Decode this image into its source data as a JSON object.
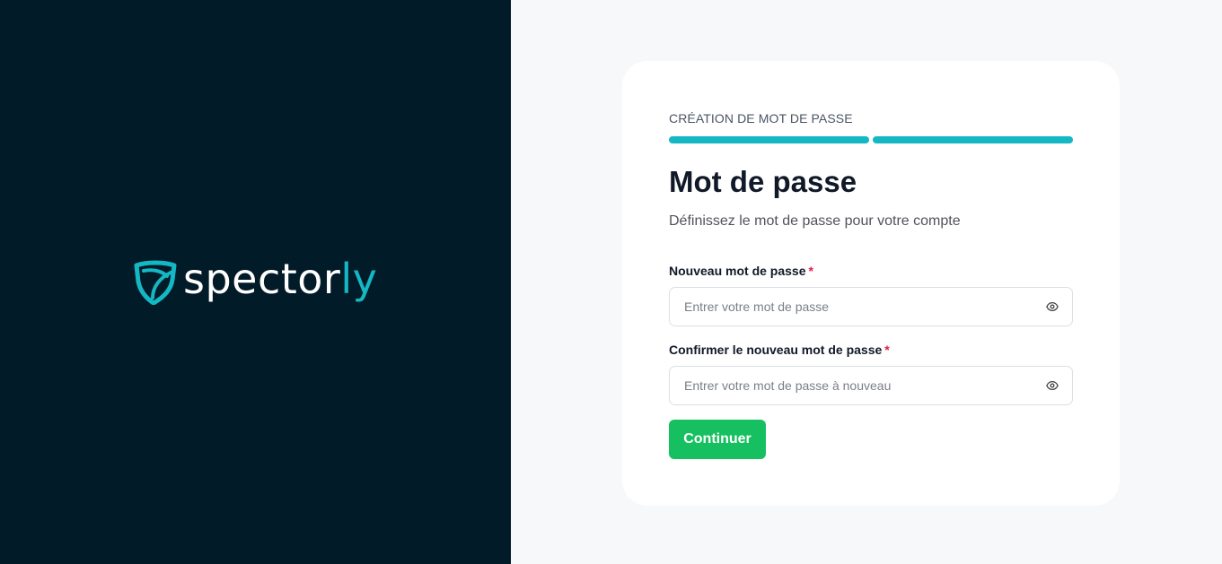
{
  "brand": {
    "name_main": "spector",
    "name_accent": "ly",
    "logo_icon": "shield-icon",
    "accent_color": "#14b8c4",
    "panel_color": "#021b28"
  },
  "form": {
    "step_label": "CRÉATION DE MOT DE PASSE",
    "progress": {
      "completed_steps": 2,
      "total_steps": 2
    },
    "title": "Mot de passe",
    "subtitle": "Définissez le mot de passe pour votre compte",
    "fields": [
      {
        "label": "Nouveau mot de passe",
        "required_mark": "*",
        "placeholder": "Entrer votre mot de passe",
        "value": "",
        "icon": "eye-icon"
      },
      {
        "label": "Confirmer le nouveau mot de passe",
        "required_mark": "*",
        "placeholder": "Entrer votre mot de passe à nouveau",
        "value": "",
        "icon": "eye-icon"
      }
    ],
    "submit_label": "Continuer",
    "submit_color": "#16c060"
  }
}
